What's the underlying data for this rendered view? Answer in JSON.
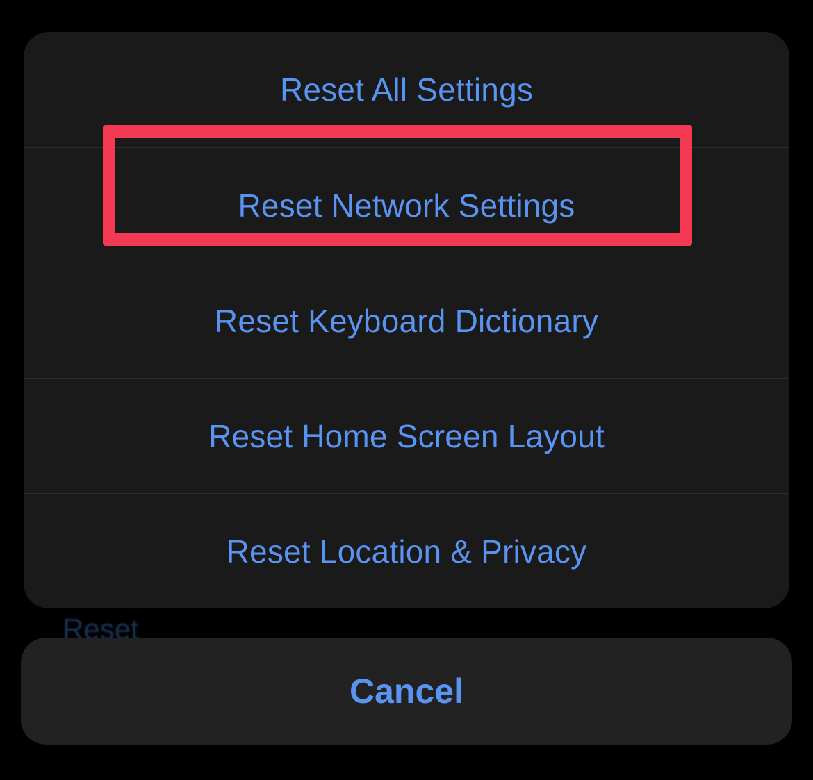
{
  "actions": {
    "reset_all": "Reset All Settings",
    "reset_network": "Reset Network Settings",
    "reset_keyboard": "Reset Keyboard Dictionary",
    "reset_home": "Reset Home Screen Layout",
    "reset_location": "Reset Location & Privacy"
  },
  "cancel_label": "Cancel",
  "background_hint": "Reset",
  "highlighted_action": "reset_network",
  "highlight_color": "#f33a52",
  "accent_color": "#5a94f2"
}
